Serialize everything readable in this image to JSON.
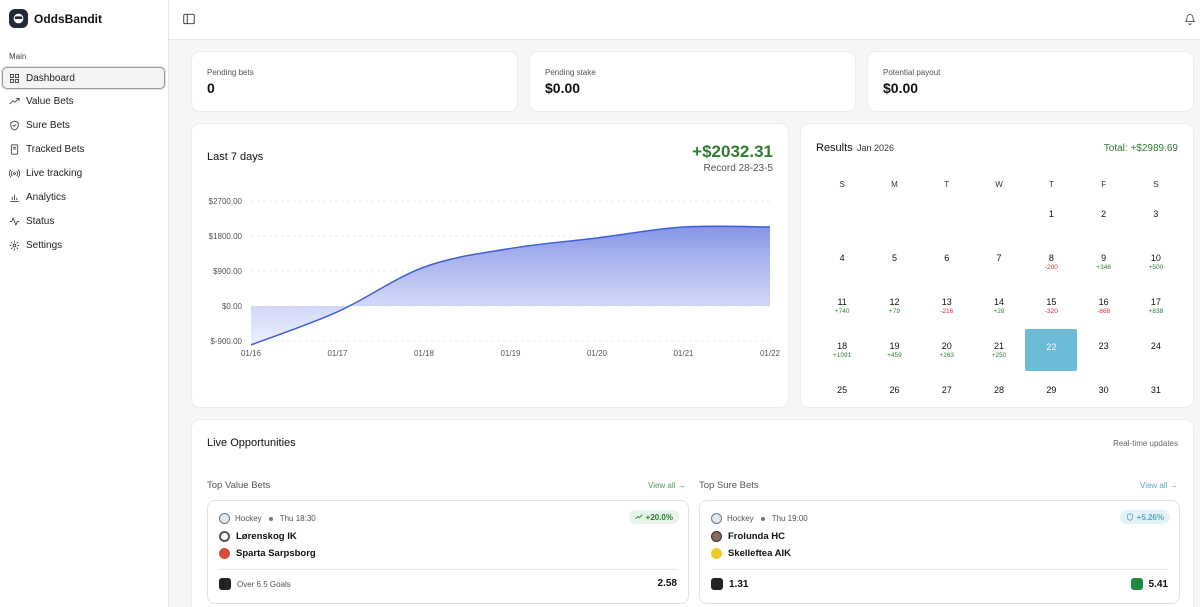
{
  "app": {
    "name": "OddsBandit"
  },
  "sidebar": {
    "section": "Main",
    "items": [
      {
        "label": "Dashboard",
        "icon": "grid-icon",
        "active": true
      },
      {
        "label": "Value Bets",
        "icon": "trending-up-icon"
      },
      {
        "label": "Sure Bets",
        "icon": "shield-icon"
      },
      {
        "label": "Tracked Bets",
        "icon": "book-icon"
      },
      {
        "label": "Live tracking",
        "icon": "broadcast-icon"
      },
      {
        "label": "Analytics",
        "icon": "bar-chart-icon"
      },
      {
        "label": "Status",
        "icon": "activity-icon"
      },
      {
        "label": "Settings",
        "icon": "gear-icon"
      }
    ]
  },
  "stats": [
    {
      "label": "Pending bets",
      "value": "0"
    },
    {
      "label": "Pending stake",
      "value": "$0.00"
    },
    {
      "label": "Potential payout",
      "value": "$0.00"
    }
  ],
  "chart": {
    "title": "Last 7 days",
    "total": "+$2032.31",
    "record": "Record 28-23-5"
  },
  "chart_data": {
    "type": "area",
    "x": [
      "01/16",
      "01/17",
      "01/18",
      "01/19",
      "01/20",
      "01/21",
      "01/22"
    ],
    "values": [
      -1000,
      -150,
      1000,
      1480,
      1750,
      2030,
      2032.31
    ],
    "y_ticks": [
      "$2700.00",
      "$1800.00",
      "$900.00",
      "$0.00",
      "$-900.00"
    ],
    "y_tick_values": [
      2700,
      1800,
      900,
      0,
      -900
    ],
    "ylim": [
      -900,
      2700
    ],
    "colors": {
      "line": "#3f5fd6",
      "fill_top": "#7f8fe6",
      "fill_bottom": "#ffffff"
    }
  },
  "calendar": {
    "title": "Results",
    "month": "Jan 2026",
    "total": "Total: +$2989.69",
    "weekdays": [
      "S",
      "M",
      "T",
      "W",
      "T",
      "F",
      "S"
    ],
    "start_offset": 4,
    "days_in_month": 31,
    "today": 22,
    "results": {
      "8": "-200",
      "9": "+346",
      "10": "+500",
      "11": "+740",
      "12": "+79",
      "13": "-216",
      "14": "+28",
      "15": "-320",
      "16": "-868",
      "17": "+838",
      "18": "+1091",
      "19": "+459",
      "20": "+263",
      "21": "+250"
    }
  },
  "live": {
    "title": "Live Opportunities",
    "subtitle": "Real-time updates",
    "value": {
      "heading": "Top Value Bets",
      "view_all": "View all →",
      "sport": "Hockey",
      "time": "Thu 18:30",
      "badge": "+20.0%",
      "team1": "Lørenskog IK",
      "team2": "Sparta Sarpsborg",
      "market": "Over 6.5 Goals",
      "odds": "2.58"
    },
    "sure": {
      "heading": "Top Sure Bets",
      "view_all": "View all →",
      "sport": "Hockey",
      "time": "Thu 19:00",
      "badge": "+5.26%",
      "team1": "Frolunda HC",
      "team2": "Skelleftea AIK",
      "odds1": "1.31",
      "odds2": "5.41"
    }
  }
}
